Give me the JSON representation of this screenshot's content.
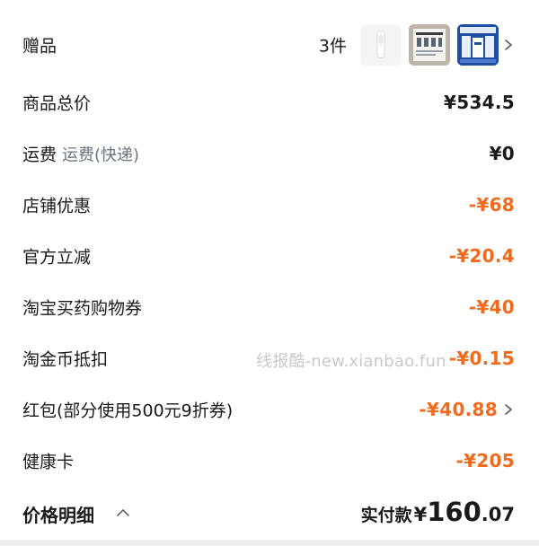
{
  "colors": {
    "discount": "#f26b1d",
    "text": "#1a1a1a",
    "muted": "#6b7480",
    "watermark": "#c9c9c9"
  },
  "gift": {
    "label": "赠品",
    "count": "3件",
    "thumb_icons": [
      "toothbrush-head-thumb",
      "instruction-card-thumb",
      "product-box-thumb"
    ]
  },
  "rows": {
    "subtotal": {
      "label": "商品总价",
      "value": "¥534.5"
    },
    "shipping": {
      "label": "运费",
      "sublabel": "运费(快递)",
      "value": "¥0"
    },
    "store_discount": {
      "label": "店铺优惠",
      "value": "-¥68"
    },
    "official_cut": {
      "label": "官方立减",
      "value": "-¥20.4"
    },
    "medicine_coupon": {
      "label": "淘宝买药购物券",
      "value": "-¥40"
    },
    "gold_coin": {
      "label": "淘金币抵扣",
      "value": "-¥0.15"
    },
    "red_packet": {
      "label": "红包(部分使用500元9折券)",
      "value": "-¥40.88"
    },
    "health_card": {
      "label": "健康卡",
      "value": "-¥205"
    }
  },
  "watermark": "线报酷-new.xianbao.fun",
  "footer": {
    "title": "价格明细",
    "total_label": "实付款",
    "total_currency": "¥",
    "total_int": "160",
    "total_dec": ".07"
  }
}
